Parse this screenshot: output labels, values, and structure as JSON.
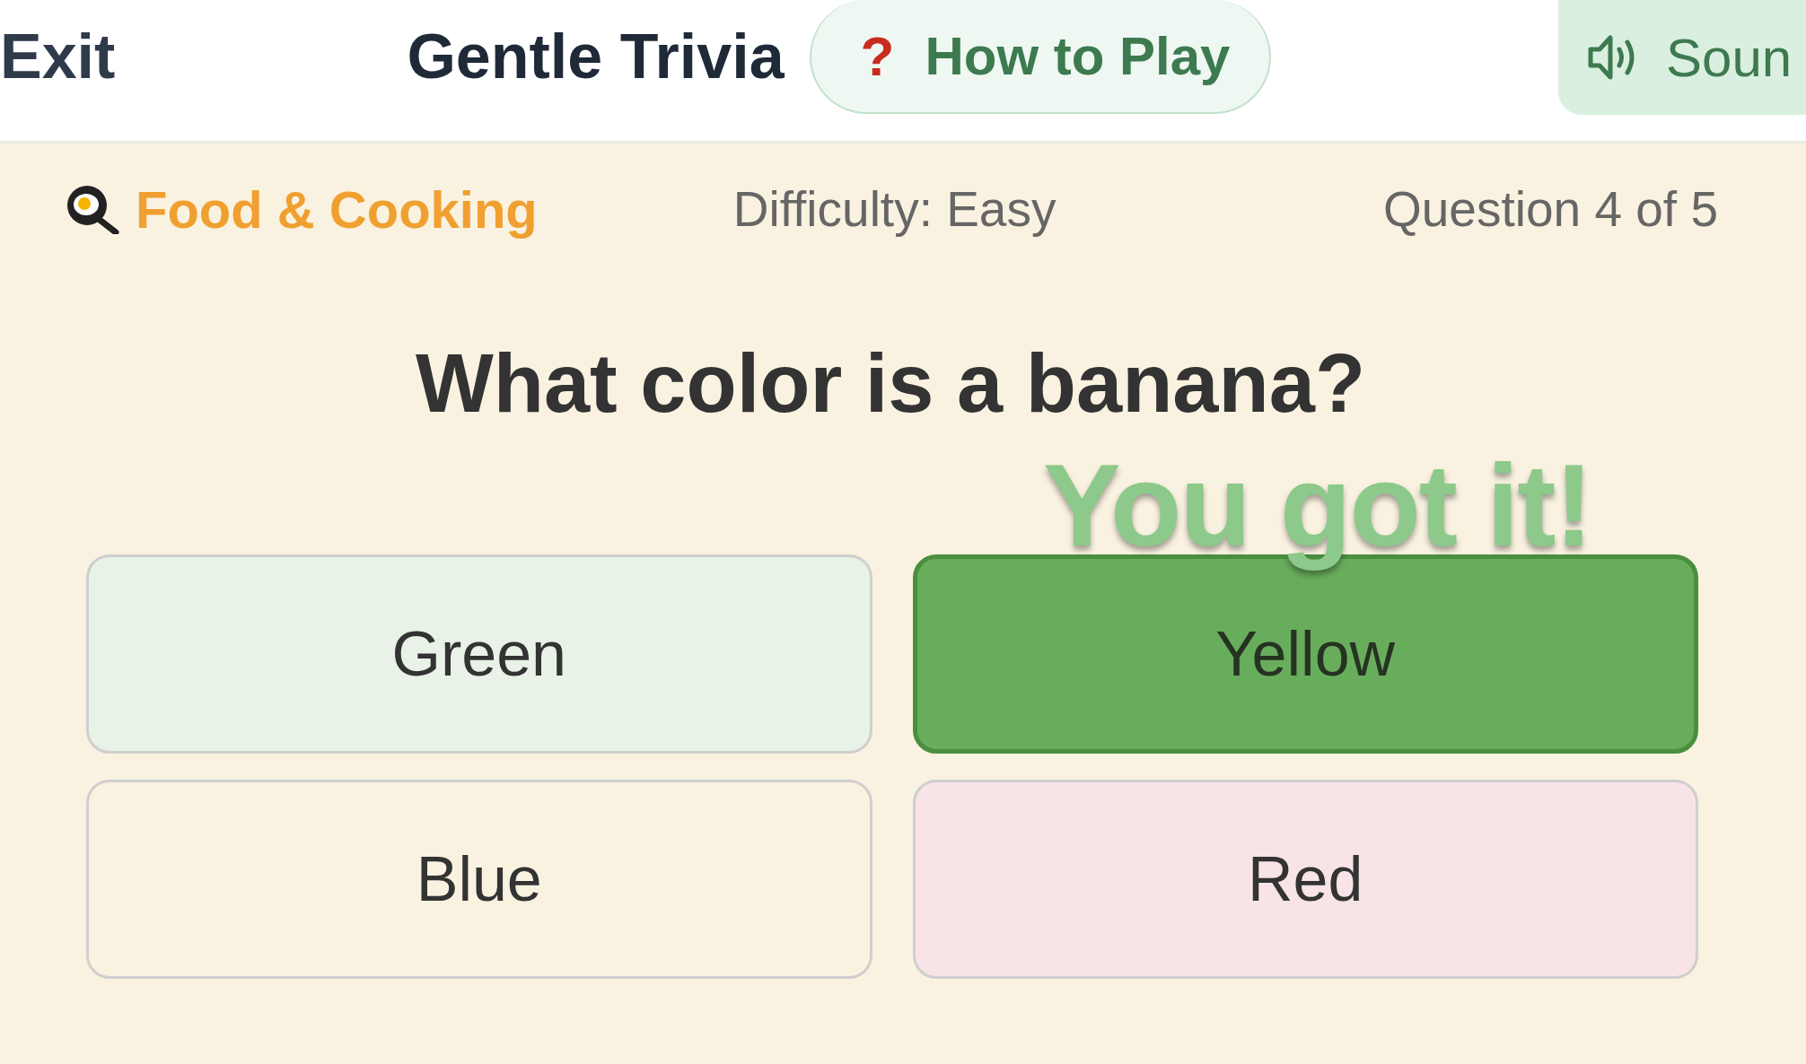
{
  "header": {
    "exit_link": "Exit",
    "title": "Gentle Trivia",
    "help_button": {
      "icon": "?",
      "label": "How to Play"
    },
    "sound_button": {
      "label": "Soun"
    }
  },
  "info_bar": {
    "category": "Food & Cooking",
    "difficulty": "Difficulty: Easy",
    "progress": "Question 4 of 5"
  },
  "question": "What color is a banana?",
  "feedback": "You got it!",
  "answers": [
    {
      "label": "Green",
      "color": "#e8f2e6",
      "selected": false
    },
    {
      "label": "Yellow",
      "color": "#68ad5c",
      "selected": true
    },
    {
      "label": "Blue",
      "color": "#faf2e1",
      "selected": false
    },
    {
      "label": "Red",
      "color": "#f8e4e6",
      "selected": false
    }
  ]
}
